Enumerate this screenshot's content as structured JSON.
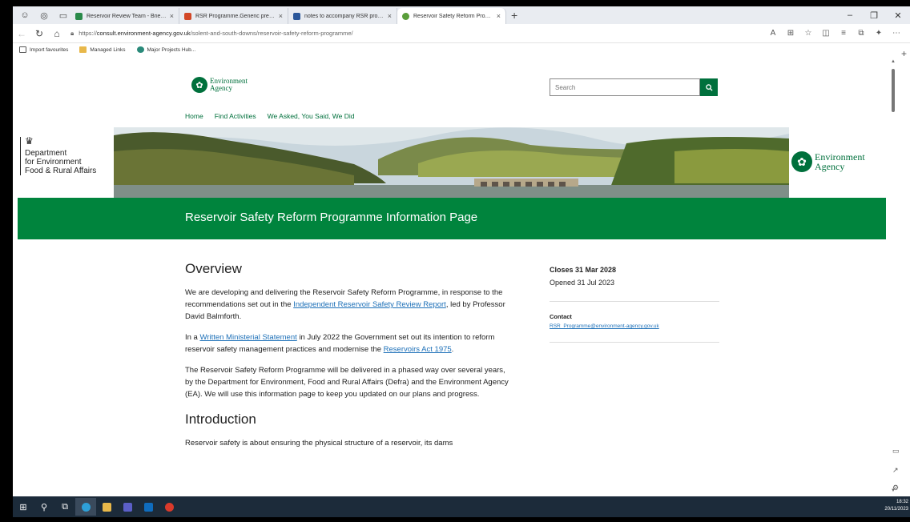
{
  "browser": {
    "tabs": [
      {
        "title": "Reservoir Review Team - Briefing",
        "color": "#2a8a4a"
      },
      {
        "title": "RSR Programme.Generic present",
        "color": "#d24726"
      },
      {
        "title": "notes to accompany RSR progra",
        "color": "#2b579a"
      },
      {
        "title": "Reservoir Safety Reform Program",
        "color": "#5a9e3a",
        "active": true
      }
    ],
    "new_tab": "+",
    "url_prefix": "https://",
    "url_host": "consult.environment-agency.gov.uk",
    "url_path": "/solent-and-south-downs/reservoir-safety-reform-programme/",
    "bookmarks": [
      "Import favourites",
      "Managed Links",
      "Major Projects Hub..."
    ]
  },
  "header": {
    "logo_line1": "Environment",
    "logo_line2": "Agency",
    "search_placeholder": "Search",
    "nav": [
      "Home",
      "Find Activities",
      "We Asked, You Said, We Did"
    ]
  },
  "banner": {
    "defra_line1": "Department",
    "defra_line2": "for Environment",
    "defra_line3": "Food & Rural Affairs",
    "ea_line1": "Environment",
    "ea_line2": "Agency"
  },
  "page_title": "Reservoir Safety Reform Programme Information Page",
  "overview": {
    "heading": "Overview",
    "p1_a": "We are developing and delivering the Reservoir Safety Reform Programme, in response to the recommendations set out in the ",
    "p1_link": "Independent Reservoir Safety Review Report",
    "p1_b": ", led by Professor David Balmforth.",
    "p2_a": "In a ",
    "p2_link1": "Written Ministerial Statement",
    "p2_b": " in July 2022 the Government set out its intention to reform reservoir safety management practices and modernise the ",
    "p2_link2": "Reservoirs Act 1975",
    "p2_c": ".",
    "p3": "The Reservoir Safety Reform Programme will be delivered in a phased way over several years, by the Department for Environment, Food and Rural Affairs (Defra) and the Environment Agency (EA). We will use this information page to keep you updated on our plans and progress."
  },
  "introduction": {
    "heading": "Introduction",
    "p1": "Reservoir safety is about ensuring the physical structure of a reservoir, its dams"
  },
  "aside": {
    "closes": "Closes 31 Mar 2028",
    "opened": "Opened 31 Jul 2023",
    "contact_label": "Contact",
    "contact_email": "RSR_Programme@environment-agency.gov.uk"
  },
  "taskbar": {
    "time": "18:32",
    "date": "20/11/2023"
  },
  "colors": {
    "brand_green": "#00843d",
    "link_blue": "#1d70b8"
  }
}
